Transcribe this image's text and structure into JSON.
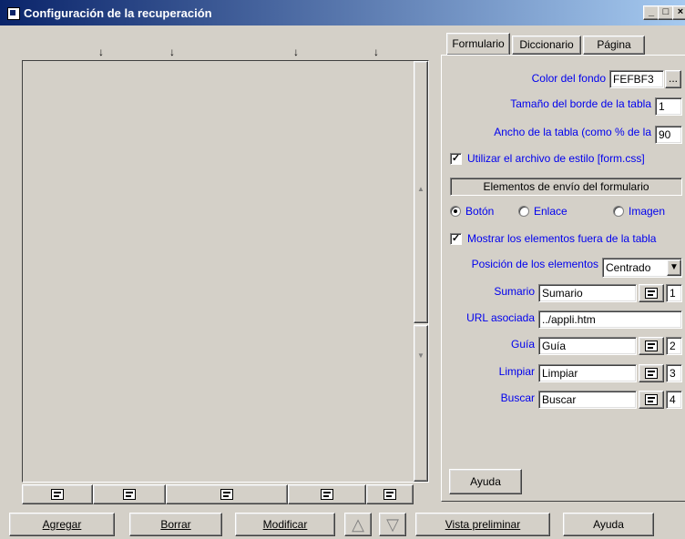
{
  "window": {
    "title": "Configuración de la recuperación",
    "minimize": "_",
    "maximize": "□",
    "close": "×"
  },
  "tabs": [
    "Formulario",
    "Diccionario",
    "Página"
  ],
  "form": {
    "bg_color_label": "Color del fondo",
    "bg_color_value": "FEFBF3",
    "bg_color_button": "...",
    "border_label": "Tamaño del borde de la tabla",
    "border_value": "1",
    "width_label": "Ancho de la tabla (como % de la",
    "width_value": "90",
    "css_checkbox_label": "Utilizar el archivo de estilo [form.css]",
    "css_checked": true,
    "submit_group_label": "Elementos de envío del formulario",
    "radio_boton": "Botón",
    "radio_enlace": "Enlace",
    "radio_imagen": "Imagen",
    "radio_selected": "Botón",
    "outside_checkbox_label": "Mostrar los elementos fuera de la tabla",
    "outside_checked": true,
    "position_label": "Posición de los elementos",
    "position_value": "Centrado",
    "rows": [
      {
        "label": "Sumario",
        "value": "Sumario",
        "order": "1"
      },
      {
        "label": "URL asociada",
        "value": "../appli.htm"
      },
      {
        "label": "Guía",
        "value": "Guía",
        "order": "2"
      },
      {
        "label": "Limpiar",
        "value": "Limpiar",
        "order": "3"
      },
      {
        "label": "Buscar",
        "value": "Buscar",
        "order": "4"
      }
    ],
    "help_button": "Ayuda"
  },
  "bottom_buttons": {
    "agregar": "Agregar",
    "borrar": "Borrar",
    "modificar": "Modificar",
    "up": "△",
    "down": "▽",
    "vista": "Vista preliminar",
    "ayuda": "Ayuda"
  },
  "check_mark": "✓",
  "arrow_glyph": "↓",
  "dropdown_glyph": "▼",
  "scroll_up_glyph": "▲",
  "scroll_down_glyph": "▼"
}
